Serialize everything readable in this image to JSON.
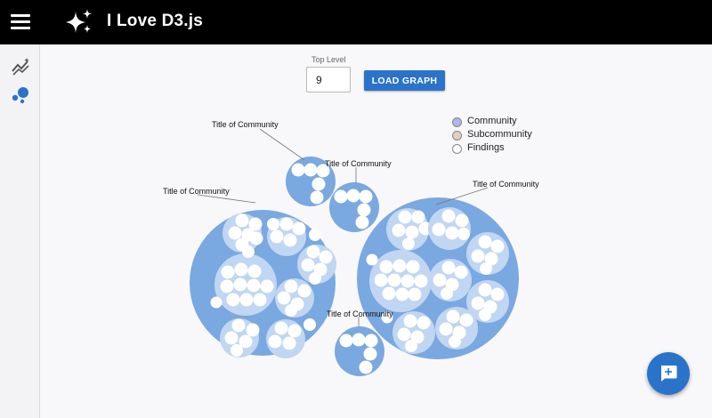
{
  "header": {
    "title": "I Love D3.js",
    "menu_icon": "hamburger-menu-icon",
    "logo_icon": "sparkle-icon"
  },
  "sidebar": {
    "items": [
      {
        "icon": "analytics-icon"
      },
      {
        "icon": "bubbles-icon",
        "color": "#2a73c9"
      }
    ]
  },
  "controls": {
    "top_level_label": "Top Level",
    "top_level_value": "9",
    "load_button_label": "LOAD GRAPH"
  },
  "legend": {
    "items": [
      {
        "label": "Community",
        "color": "#b1b4ee"
      },
      {
        "label": "Subcommunity",
        "color": "#e2cfc4"
      },
      {
        "label": "Findings",
        "color": "#ffffff"
      }
    ]
  },
  "graph": {
    "community_color": "#7aa8e0",
    "subcommunity_color": "#c0d6f2",
    "finding_color": "#ffffff",
    "labels": [
      "Title of Community",
      "Title of Community",
      "Title of Community",
      "Title of Community",
      "Title of Community"
    ]
  },
  "fab": {
    "icon": "chat-add-icon",
    "color": "#2a73c9"
  }
}
